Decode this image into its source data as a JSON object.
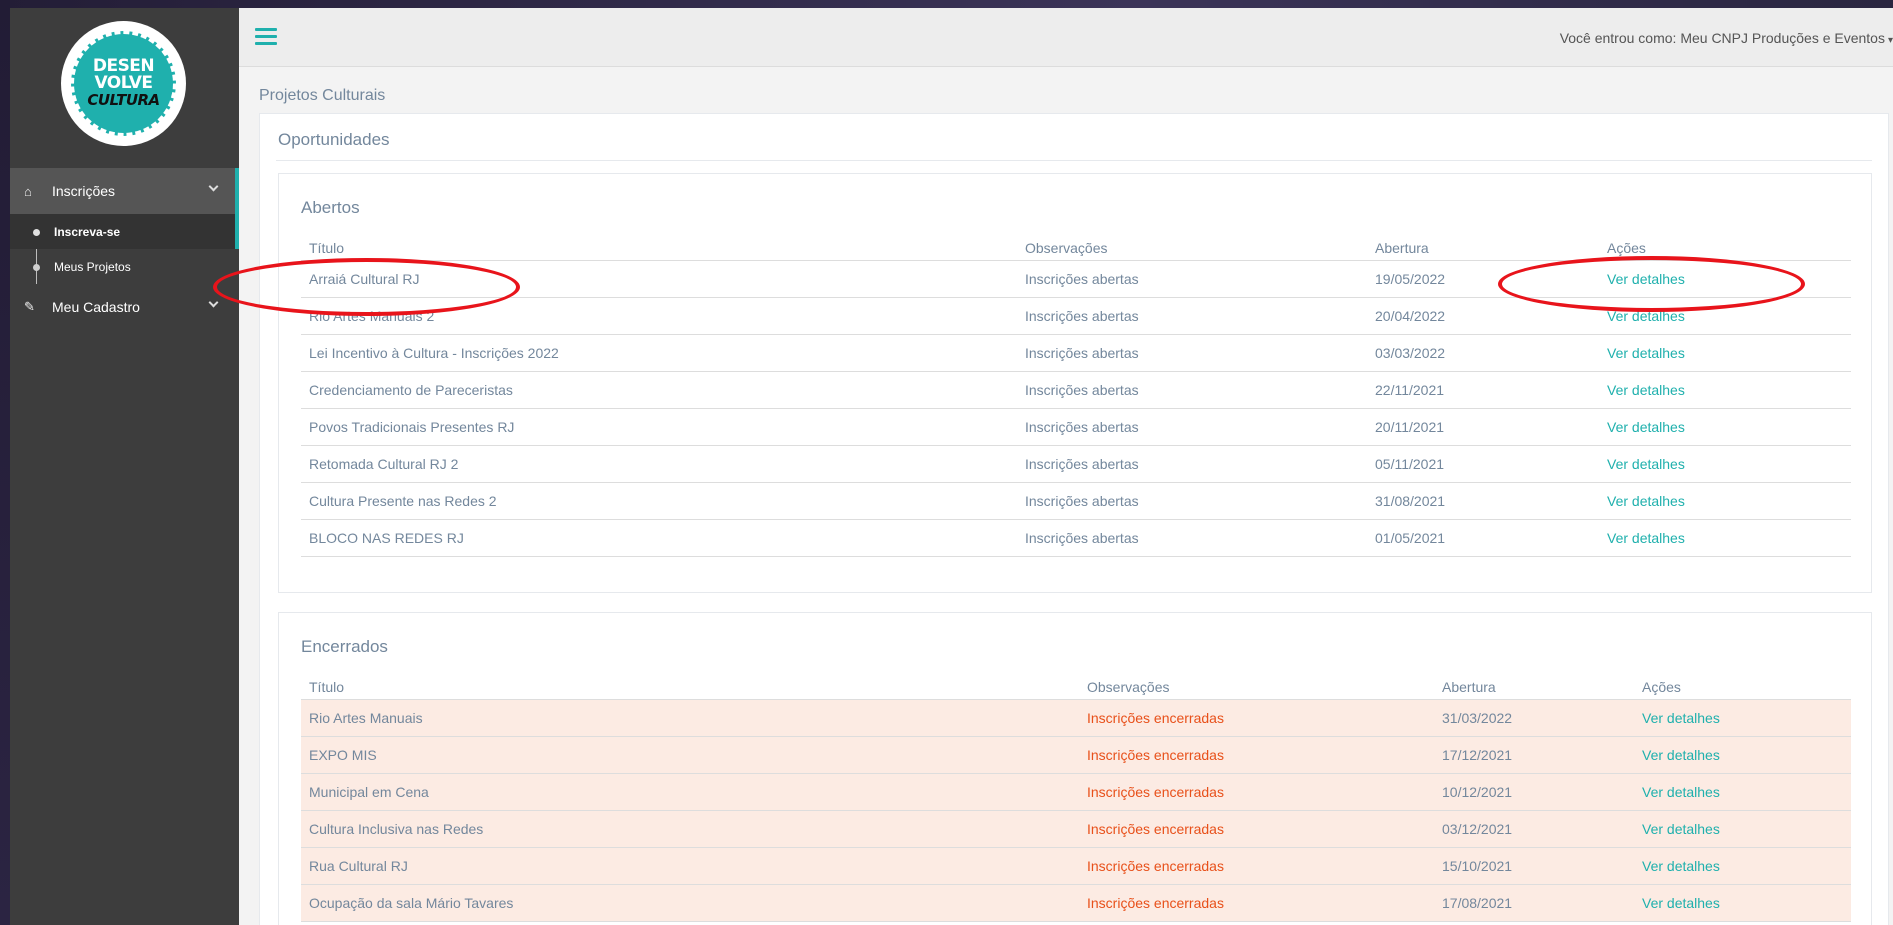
{
  "logo": {
    "line1": "DESEN",
    "line2": "VOLVE",
    "line3": "CULTURA"
  },
  "sidebar": {
    "items": [
      {
        "label": "Inscrições",
        "icon": "home-icon"
      },
      {
        "label": "Meu Cadastro",
        "icon": "edit-icon"
      }
    ],
    "subitems": [
      {
        "label": "Inscreva-se"
      },
      {
        "label": "Meus Projetos"
      }
    ]
  },
  "topbar": {
    "user_text": "Você entrou como: Meu CNPJ Produções e Eventos"
  },
  "page": {
    "title": "Projetos Culturais",
    "panel_title": "Oportunidades"
  },
  "open_section": {
    "title": "Abertos",
    "headers": [
      "Título",
      "Observações",
      "Abertura",
      "Ações"
    ],
    "rows": [
      [
        "Arraiá Cultural RJ",
        "Inscrições abertas",
        "19/05/2022",
        "Ver detalhes"
      ],
      [
        "Rio Artes Manuais 2",
        "Inscrições abertas",
        "20/04/2022",
        "Ver detalhes"
      ],
      [
        "Lei Incentivo à Cultura - Inscrições 2022",
        "Inscrições abertas",
        "03/03/2022",
        "Ver detalhes"
      ],
      [
        "Credenciamento de Pareceristas",
        "Inscrições abertas",
        "22/11/2021",
        "Ver detalhes"
      ],
      [
        "Povos Tradicionais Presentes RJ",
        "Inscrições abertas",
        "20/11/2021",
        "Ver detalhes"
      ],
      [
        "Retomada Cultural RJ 2",
        "Inscrições abertas",
        "05/11/2021",
        "Ver detalhes"
      ],
      [
        "Cultura Presente nas Redes 2",
        "Inscrições abertas",
        "31/08/2021",
        "Ver detalhes"
      ],
      [
        "BLOCO NAS REDES RJ",
        "Inscrições abertas",
        "01/05/2021",
        "Ver detalhes"
      ]
    ]
  },
  "closed_section": {
    "title": "Encerrados",
    "headers": [
      "Título",
      "Observações",
      "Abertura",
      "Ações"
    ],
    "rows": [
      [
        "Rio Artes Manuais",
        "Inscrições encerradas",
        "31/03/2022",
        "Ver detalhes"
      ],
      [
        "EXPO MIS",
        "Inscrições encerradas",
        "17/12/2021",
        "Ver detalhes"
      ],
      [
        "Municipal em Cena",
        "Inscrições encerradas",
        "10/12/2021",
        "Ver detalhes"
      ],
      [
        "Cultura Inclusiva nas Redes",
        "Inscrições encerradas",
        "03/12/2021",
        "Ver detalhes"
      ],
      [
        "Rua Cultural RJ",
        "Inscrições encerradas",
        "15/10/2021",
        "Ver detalhes"
      ],
      [
        "Ocupação da sala Mário Tavares",
        "Inscrições encerradas",
        "17/08/2021",
        "Ver detalhes"
      ]
    ]
  },
  "colors": {
    "accent": "#1fb0ad",
    "closed_text": "#e8501a",
    "closed_row_bg": "#fcebe3",
    "annotation": "#e8141b"
  }
}
